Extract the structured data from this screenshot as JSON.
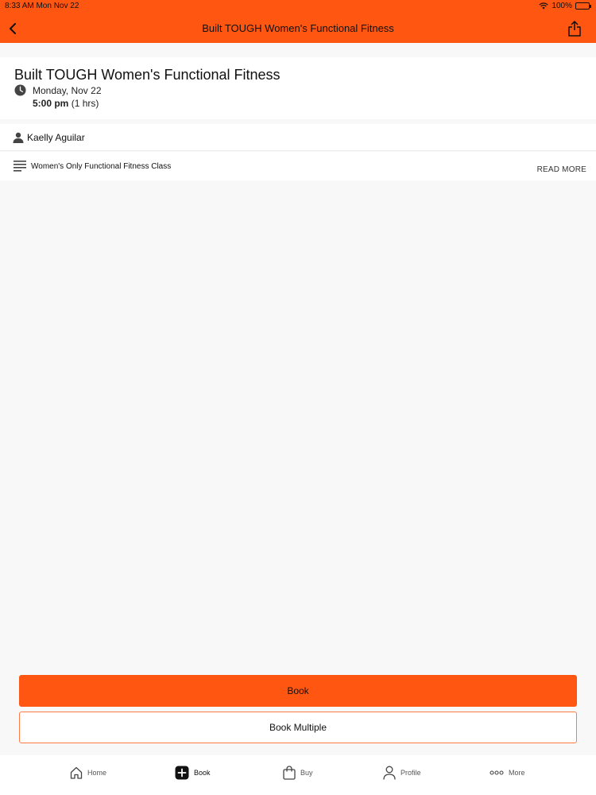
{
  "status_bar": {
    "time": "8:33 AM Mon Nov 22",
    "battery": "100%",
    "battery_level": 1.0
  },
  "header": {
    "title": "Built TOUGH Women's Functional Fitness",
    "back_icon": "chevron-left-icon",
    "share_icon": "share-icon"
  },
  "class": {
    "title": "Built TOUGH Women's Functional Fitness",
    "date": "Monday, Nov 22",
    "start_time": "5:00 pm",
    "duration": "(1 hrs)",
    "instructor": "Kaelly Aguilar",
    "description": "Women's Only Functional Fitness Class",
    "read_more": "READ MORE"
  },
  "actions": {
    "book_label": "Book",
    "book_multiple_label": "Book Multiple"
  },
  "tabs": [
    {
      "label": "Home",
      "icon": "home-icon"
    },
    {
      "label": "Book",
      "icon": "plus-square-icon",
      "active": true
    },
    {
      "label": "Buy",
      "icon": "shopping-bag-icon"
    },
    {
      "label": "Profile",
      "icon": "person-icon"
    },
    {
      "label": "More",
      "icon": "more-dots-icon"
    }
  ],
  "colors": {
    "accent": "#ff5611",
    "background": "#f8f8f9"
  }
}
